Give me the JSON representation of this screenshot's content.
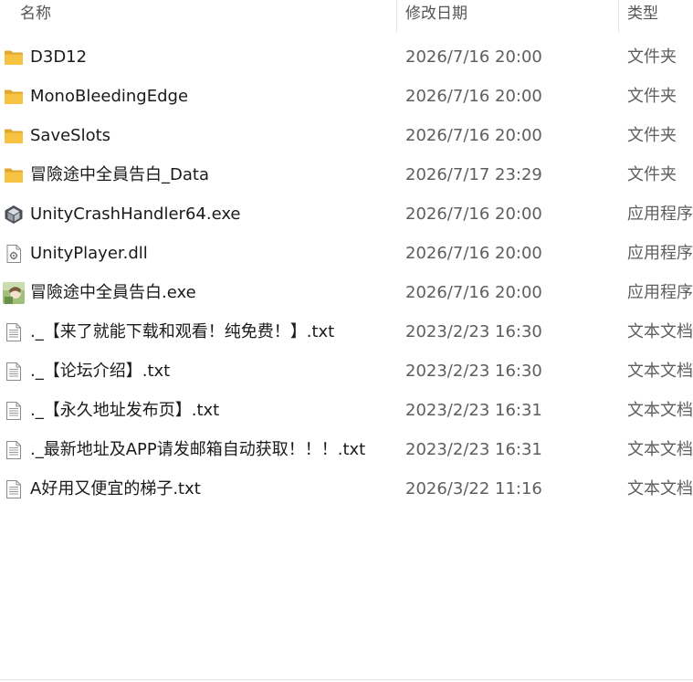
{
  "columns": {
    "name": "名称",
    "modified": "修改日期",
    "type": "类型"
  },
  "files": [
    {
      "name": "D3D12",
      "modified": "2026/7/16 20:00",
      "type": "文件夹",
      "icon": "folder-icon"
    },
    {
      "name": "MonoBleedingEdge",
      "modified": "2026/7/16 20:00",
      "type": "文件夹",
      "icon": "folder-icon"
    },
    {
      "name": "SaveSlots",
      "modified": "2026/7/16 20:00",
      "type": "文件夹",
      "icon": "folder-icon"
    },
    {
      "name": "冒險途中全員告白_Data",
      "modified": "2026/7/17 23:29",
      "type": "文件夹",
      "icon": "folder-icon"
    },
    {
      "name": "UnityCrashHandler64.exe",
      "modified": "2026/7/16 20:00",
      "type": "应用程序",
      "icon": "unity-icon"
    },
    {
      "name": "UnityPlayer.dll",
      "modified": "2026/7/16 20:00",
      "type": "应用程序",
      "icon": "dll-file-icon"
    },
    {
      "name": "冒險途中全員告白.exe",
      "modified": "2026/7/16 20:00",
      "type": "应用程序",
      "icon": "game-app-icon"
    },
    {
      "name": "._【来了就能下载和观看！纯免费！】.txt",
      "modified": "2023/2/23 16:30",
      "type": "文本文档",
      "icon": "text-file-icon"
    },
    {
      "name": "._【论坛介绍】.txt",
      "modified": "2023/2/23 16:30",
      "type": "文本文档",
      "icon": "text-file-icon"
    },
    {
      "name": "._【永久地址发布页】.txt",
      "modified": "2023/2/23 16:31",
      "type": "文本文档",
      "icon": "text-file-icon"
    },
    {
      "name": "._最新地址及APP请发邮箱自动获取！！！.txt",
      "modified": "2023/2/23 16:31",
      "type": "文本文档",
      "icon": "text-file-icon"
    },
    {
      "name": "A好用又便宜的梯子.txt",
      "modified": "2026/3/22 11:16",
      "type": "文本文档",
      "icon": "text-file-icon"
    }
  ],
  "colors": {
    "folder": "#f5c242",
    "folder_dark": "#e0a82e",
    "unity": "#4a4f55"
  }
}
